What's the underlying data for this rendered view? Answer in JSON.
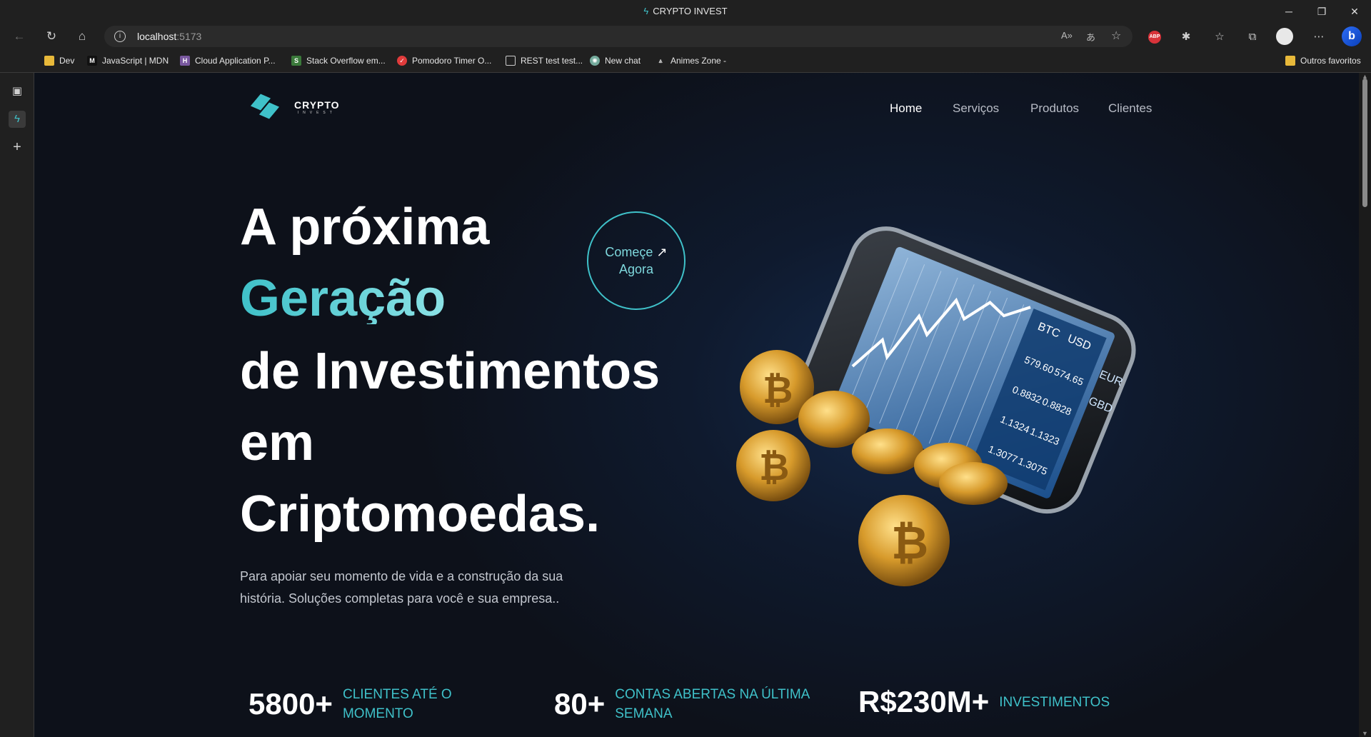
{
  "browser": {
    "window_title": "CRYPTO INVEST",
    "url_host": "localhost",
    "url_port": ":5173",
    "bookmarks": [
      {
        "label": "Dev",
        "icon": "folder-icon"
      },
      {
        "label": "JavaScript | MDN",
        "icon": "mdn-icon"
      },
      {
        "label": "Cloud Application P...",
        "icon": "heroku-icon"
      },
      {
        "label": "Stack Overflow em...",
        "icon": "stackoverflow-icon"
      },
      {
        "label": "Pomodoro Timer O...",
        "icon": "pomodoro-icon"
      },
      {
        "label": "REST test test...",
        "icon": "page-icon"
      },
      {
        "label": "New chat",
        "icon": "chatgpt-icon"
      },
      {
        "label": "Animes Zone -",
        "icon": "anime-icon"
      }
    ],
    "other_favorites": "Outros favoritos"
  },
  "site": {
    "logo_title": "CRYPTO",
    "logo_subtitle": "INVEST",
    "nav": [
      {
        "label": "Home",
        "active": true
      },
      {
        "label": "Serviços",
        "active": false
      },
      {
        "label": "Produtos",
        "active": false
      },
      {
        "label": "Clientes",
        "active": false
      }
    ],
    "hero": {
      "line1": "A próxima",
      "line2": "Geração",
      "line3": "de Investimentos",
      "line4": "em",
      "line5": "Criptomoedas.",
      "cta_line1": "Começe",
      "cta_arrow": "↗",
      "cta_line2": "Agora",
      "lead": "Para apoiar seu momento de vida e a construção da sua história. Soluções completas para você e sua empresa.."
    },
    "stats": [
      {
        "value": "5800+",
        "label_line1": "CLIENTES ATÉ O",
        "label_line2": "MOMENTO"
      },
      {
        "value": "80+",
        "label_line1": "CONTAS ABERTAS NA ÚLTIMA",
        "label_line2": "SEMANA"
      },
      {
        "value": "R$230M+",
        "label_line1": "INVESTIMENTOS",
        "label_line2": ""
      }
    ],
    "phone_screen": {
      "currencies": [
        "BTC",
        "USD",
        "EUR",
        "GBD"
      ],
      "values": [
        "579.60",
        "574.65",
        "0.8832",
        "0.8828",
        "1.1324",
        "1.1323",
        "1.3077",
        "1.3075"
      ]
    },
    "colors": {
      "accent": "#3fc1c9",
      "background": "#0d111a"
    }
  }
}
